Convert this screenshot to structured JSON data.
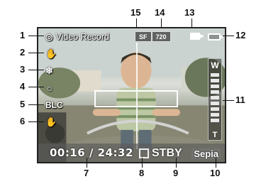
{
  "screen": {
    "mode_label": "Video Record",
    "quality": [
      "SF",
      "720"
    ],
    "blc_label": "BLC",
    "zoom_top": "W",
    "zoom_bottom": "T",
    "timecode": "00:16 / 24:32",
    "status": "STBY",
    "effect": "Sepia"
  },
  "callouts": [
    "1",
    "2",
    "3",
    "4",
    "5",
    "6",
    "7",
    "8",
    "9",
    "10",
    "11",
    "12",
    "13",
    "14",
    "15"
  ],
  "icons": {
    "mode": "video-camera-icon",
    "hand1": "hand-icon",
    "snowflake": "snowflake-icon",
    "sun": "sun-icon",
    "hand2": "hand-stop-icon",
    "battery": "battery-icon",
    "card": "tape-icon"
  }
}
